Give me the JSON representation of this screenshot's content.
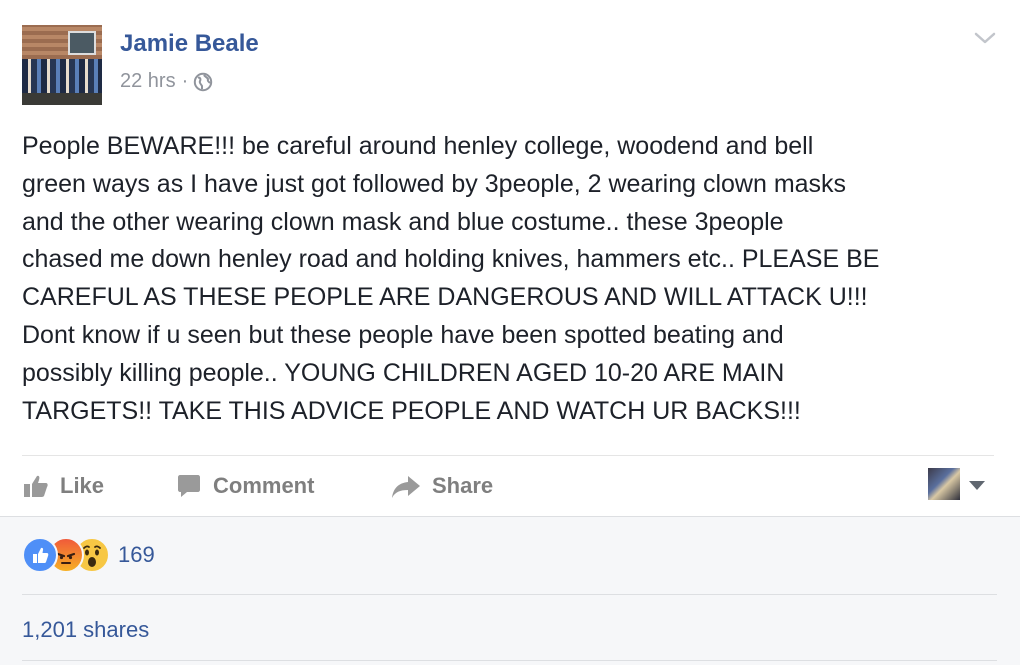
{
  "post": {
    "author": "Jamie Beale",
    "time": "22 hrs",
    "separator": "·",
    "privacy_icon": "globe-icon",
    "menu_icon": "chevron-down-icon",
    "body_lines": [
      "People BEWARE!!! be careful around henley college, woodend and bell",
      "green ways as I have just got followed by 3people, 2 wearing clown masks",
      "and the other wearing clown mask and blue costume.. these 3people",
      "chased me down henley road and holding knives, hammers etc.. PLEASE BE",
      "CAREFUL AS THESE PEOPLE ARE DANGEROUS AND WILL ATTACK U!!!",
      "Dont know if u seen but these people have been spotted beating and",
      "possibly killing people.. YOUNG CHILDREN AGED 10-20 ARE MAIN",
      "TARGETS!! TAKE THIS ADVICE PEOPLE AND WATCH UR BACKS!!!"
    ]
  },
  "actions": {
    "like": "Like",
    "comment": "Comment",
    "share": "Share",
    "icons": [
      "thumbs-up-icon",
      "comment-icon",
      "share-arrow-icon",
      "caret-down-icon"
    ]
  },
  "stats": {
    "reactions": [
      "like",
      "angry",
      "wow"
    ],
    "reaction_count": "169",
    "shares": "1,201 shares"
  },
  "colors": {
    "link": "#365899",
    "muted": "#90949c",
    "action": "#7f7f7f",
    "text": "#1d2129",
    "band": "#f6f7f9"
  }
}
